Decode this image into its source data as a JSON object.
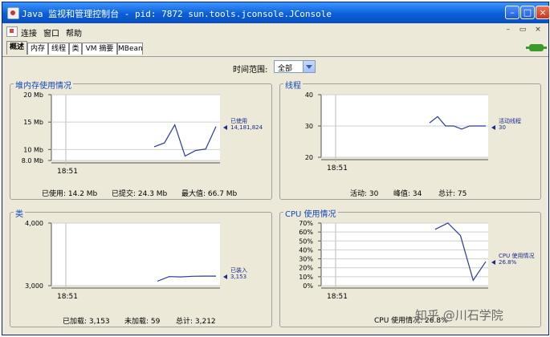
{
  "window": {
    "title": "Java 监视和管理控制台 - pid: 7872 sun.tools.jconsole.JConsole",
    "minimize": "–",
    "maximize": "□",
    "close": "×"
  },
  "menubar": {
    "items": [
      "连接",
      "窗口",
      "帮助"
    ],
    "mdi": [
      "–",
      "▭",
      "×"
    ]
  },
  "tabs": [
    "概述",
    "内存",
    "线程",
    "类",
    "VM 摘要",
    "MBean"
  ],
  "active_tab": "概述",
  "time_range": {
    "label": "时间范围:",
    "value": "全部"
  },
  "panels": {
    "heap": {
      "title": "堆内存使用情况",
      "legend_name": "已使用",
      "legend_value": "14,181,824",
      "stats": [
        "已使用: 14.2 Mb",
        "已提交: 24.3 Mb",
        "最大值: 66.7 Mb"
      ]
    },
    "threads": {
      "title": "线程",
      "legend_name": "活动线程",
      "legend_value": "30",
      "stats": [
        "活动: 30",
        "峰值: 34",
        "总计: 75"
      ]
    },
    "classes": {
      "title": "类",
      "legend_name": "已装入",
      "legend_value": "3,153",
      "stats": [
        "已加载: 3,153",
        "未加载: 59",
        "总计: 3,212"
      ]
    },
    "cpu": {
      "title": "CPU 使用情况",
      "legend_name": "CPU 使用情况",
      "legend_value": "26.8%",
      "stats": [
        "CPU 使用情况: 26.8%"
      ]
    }
  },
  "watermark": "知乎 @川石学院",
  "chart_data": [
    {
      "type": "line",
      "title": "堆内存使用情况",
      "x_tick": "18:51",
      "y_ticks": [
        "20 Mb",
        "15 Mb",
        "10 Mb",
        "8.0 Mb"
      ],
      "ylim": [
        8,
        20
      ],
      "series": [
        {
          "name": "已使用",
          "values": [
            10.5,
            11.2,
            14.5,
            8.8,
            9.8,
            10.1,
            14.2
          ]
        }
      ]
    },
    {
      "type": "line",
      "title": "线程",
      "x_tick": "18:51",
      "y_ticks": [
        "40",
        "30",
        "20"
      ],
      "ylim": [
        20,
        40
      ],
      "series": [
        {
          "name": "活动线程",
          "values": [
            31,
            33,
            30,
            30,
            29,
            30,
            30,
            30
          ]
        }
      ]
    },
    {
      "type": "line",
      "title": "类",
      "x_tick": "18:51",
      "y_ticks": [
        "4,000",
        "3,000"
      ],
      "ylim": [
        3000,
        4000
      ],
      "series": [
        {
          "name": "已装入",
          "values": [
            3070,
            3145,
            3140,
            3150,
            3153,
            3153
          ]
        }
      ]
    },
    {
      "type": "line",
      "title": "CPU 使用情况",
      "x_tick": "18:51",
      "y_ticks": [
        "70%",
        "60%",
        "50%",
        "40%",
        "30%",
        "20%",
        "10%",
        "0%"
      ],
      "ylim": [
        0,
        70
      ],
      "series": [
        {
          "name": "CPU 使用情况",
          "values": [
            63,
            70,
            56,
            6,
            26.8
          ]
        }
      ]
    }
  ]
}
